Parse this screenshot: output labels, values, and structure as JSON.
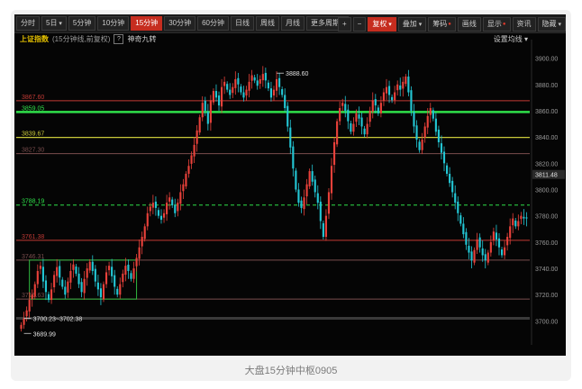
{
  "toolbar": {
    "left": [
      {
        "label": "分时",
        "active": false,
        "dd": false
      },
      {
        "label": "5日",
        "active": false,
        "dd": true
      },
      {
        "label": "5分钟",
        "active": false,
        "dd": false
      },
      {
        "label": "10分钟",
        "active": false,
        "dd": false
      },
      {
        "label": "15分钟",
        "active": true,
        "dd": false
      },
      {
        "label": "30分钟",
        "active": false,
        "dd": false
      },
      {
        "label": "60分钟",
        "active": false,
        "dd": false
      },
      {
        "label": "日线",
        "active": false,
        "dd": false
      },
      {
        "label": "周线",
        "active": false,
        "dd": false
      },
      {
        "label": "月线",
        "active": false,
        "dd": false
      },
      {
        "label": "更多周期",
        "active": false,
        "dd": true
      }
    ],
    "right": [
      {
        "label": "+",
        "active": false,
        "dd": false,
        "dot": false
      },
      {
        "label": "−",
        "active": false,
        "dd": false,
        "dot": false
      },
      {
        "label": "复权",
        "active": true,
        "dd": true,
        "dot": false
      },
      {
        "label": "叠加",
        "active": false,
        "dd": true,
        "dot": false
      },
      {
        "label": "筹码",
        "active": false,
        "dd": false,
        "dot": true
      },
      {
        "label": "画线",
        "active": false,
        "dd": false,
        "dot": false
      },
      {
        "label": "显示",
        "active": false,
        "dd": true,
        "dot": true
      },
      {
        "label": "资讯",
        "active": false,
        "dd": false,
        "dot": false
      },
      {
        "label": "隐藏",
        "active": false,
        "dd": true,
        "dot": false
      }
    ]
  },
  "info": {
    "index_name": "上证指数",
    "period_note": "(15分钟线,前复权)",
    "help": "?",
    "indicator": "神奇九转"
  },
  "settings_label": "设置均线",
  "caption": "大盘15分钟中枢0905",
  "colors": {
    "up": "#e8413a",
    "down": "#23c6d4",
    "green": "#2fe04a",
    "yellow": "#c9c93a",
    "red": "#c23a35",
    "brown": "#7a4d4d",
    "nine": "#d9c23a"
  },
  "chart_data": {
    "type": "candlestick",
    "title": "上证指数",
    "ylim": [
      3690,
      3910
    ],
    "yticks": [
      3700.0,
      3720.0,
      3740.0,
      3760.0,
      3780.0,
      3800.0,
      3820.0,
      3840.0,
      3860.0,
      3880.0,
      3900.0
    ],
    "current_price": 3811.48,
    "levels": [
      {
        "value": 3867.6,
        "label": "3867.60",
        "color": "red",
        "style": "solid",
        "width": 1
      },
      {
        "value": 3859.05,
        "label": "3859.05",
        "color": "green",
        "style": "solid",
        "width": 2.5
      },
      {
        "value": 3839.67,
        "label": "3839.67",
        "color": "yellow",
        "style": "solid",
        "width": 1.3
      },
      {
        "value": 3827.3,
        "label": "3827.30",
        "color": "brown",
        "style": "solid",
        "width": 1
      },
      {
        "value": 3788.19,
        "label": "3788.19",
        "color": "green",
        "style": "dashed",
        "width": 1
      },
      {
        "value": 3761.38,
        "label": "3761.38",
        "color": "red",
        "style": "solid",
        "width": 1
      },
      {
        "value": 3746.31,
        "label": "3746.31",
        "color": "brown",
        "style": "solid",
        "width": 1
      },
      {
        "value": 3716.63,
        "label": "3716.63",
        "color": "brown",
        "style": "solid",
        "width": 1
      }
    ],
    "pivot_box": {
      "x_start": 3,
      "x_end": 42,
      "high": 3746.31,
      "low": 3716.63
    },
    "annotations": [
      {
        "text": "3888.60",
        "index": 93,
        "value": 3888.6,
        "side": "right"
      },
      {
        "text": "3700.23~3702.38",
        "index": 1,
        "value": 3702.0,
        "side": "right"
      },
      {
        "text": "3689.99",
        "index": 1,
        "value": 3690.5,
        "side": "right"
      }
    ],
    "closes": [
      3697,
      3702,
      3708,
      3716,
      3720,
      3728,
      3738,
      3742,
      3730,
      3722,
      3716,
      3724,
      3735,
      3741,
      3733,
      3726,
      3720,
      3730,
      3738,
      3743,
      3736,
      3728,
      3722,
      3732,
      3740,
      3745,
      3738,
      3730,
      3724,
      3718,
      3728,
      3737,
      3742,
      3734,
      3726,
      3720,
      3728,
      3736,
      3742,
      3738,
      3732,
      3740,
      3748,
      3756,
      3764,
      3772,
      3782,
      3787,
      3790,
      3786,
      3780,
      3777,
      3782,
      3790,
      3794,
      3788,
      3782,
      3790,
      3798,
      3804,
      3812,
      3818,
      3826,
      3834,
      3845,
      3855,
      3866,
      3860,
      3850,
      3868,
      3875,
      3870,
      3864,
      3878,
      3882,
      3876,
      3872,
      3878,
      3884,
      3880,
      3874,
      3870,
      3876,
      3882,
      3887,
      3883,
      3879,
      3884,
      3888,
      3883,
      3877,
      3870,
      3876,
      3884,
      3878,
      3872,
      3862,
      3848,
      3832,
      3816,
      3800,
      3790,
      3786,
      3794,
      3804,
      3814,
      3806,
      3798,
      3790,
      3776,
      3764,
      3780,
      3798,
      3818,
      3836,
      3852,
      3862,
      3866,
      3860,
      3852,
      3844,
      3850,
      3858,
      3854,
      3848,
      3842,
      3850,
      3860,
      3868,
      3864,
      3858,
      3866,
      3874,
      3878,
      3872,
      3868,
      3874,
      3880,
      3876,
      3882,
      3886,
      3874,
      3860,
      3848,
      3838,
      3830,
      3838,
      3848,
      3856,
      3862,
      3854,
      3844,
      3836,
      3828,
      3820,
      3812,
      3805,
      3798,
      3790,
      3782,
      3774,
      3766,
      3758,
      3752,
      3746,
      3754,
      3762,
      3756,
      3750,
      3746,
      3752,
      3760,
      3768,
      3762,
      3756,
      3750,
      3756,
      3764,
      3772,
      3778,
      3772,
      3776,
      3780,
      3778,
      3778
    ]
  }
}
